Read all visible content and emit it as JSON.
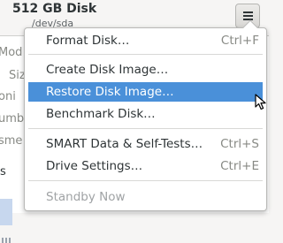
{
  "header": {
    "title": "512 GB Disk",
    "device": "/dev/sda",
    "menu_icon": "hamburger-menu-icon"
  },
  "background": {
    "fragments": [
      "Mod",
      "Siz",
      "oni",
      "umb",
      "sme",
      "s"
    ]
  },
  "menu": {
    "items": [
      {
        "label": "Format Disk…",
        "shortcut": "Ctrl+F"
      },
      {
        "label": "Create Disk Image…",
        "shortcut": ""
      },
      {
        "label": "Restore Disk Image…",
        "shortcut": "",
        "highlighted": true
      },
      {
        "label": "Benchmark Disk…",
        "shortcut": ""
      },
      {
        "label": "SMART Data & Self-Tests…",
        "shortcut": "Ctrl+S"
      },
      {
        "label": "Drive Settings…",
        "shortcut": "Ctrl+E"
      },
      {
        "label": "Standby Now",
        "shortcut": "",
        "disabled": true
      }
    ]
  },
  "colors": {
    "highlight": "#4a90d9",
    "background": "#f6f5f4"
  }
}
